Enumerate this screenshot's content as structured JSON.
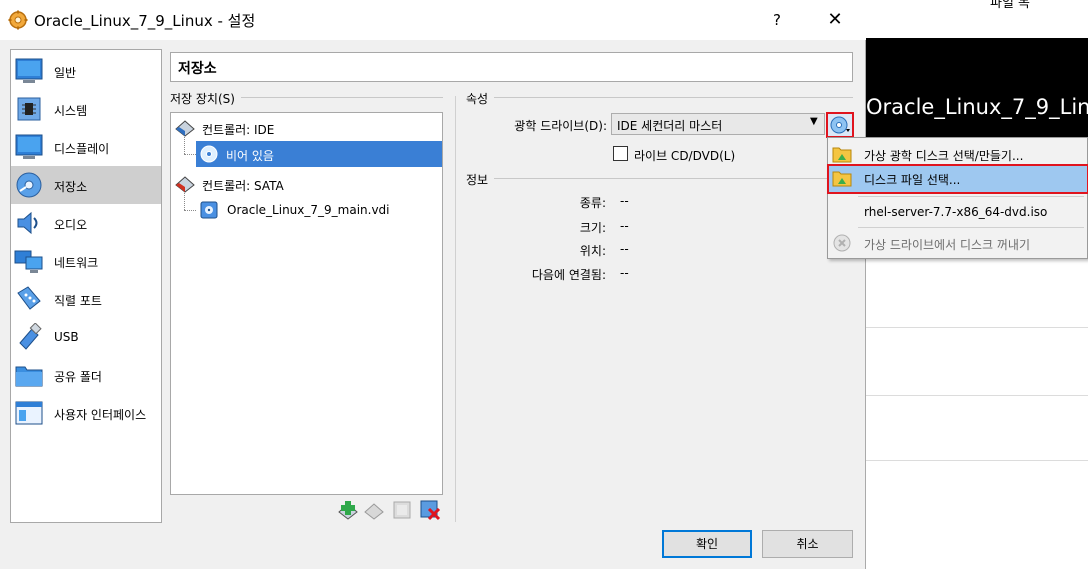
{
  "background_window": {
    "title_fragment": "파일 목",
    "preview_text": "Oracle_Linux_7_9_Lin"
  },
  "dialog": {
    "title": "Oracle_Linux_7_9_Linux - 설정",
    "help_label": "?",
    "close_label": "✕"
  },
  "nav": {
    "items": [
      {
        "label": "일반",
        "icon": "general-icon"
      },
      {
        "label": "시스템",
        "icon": "system-icon"
      },
      {
        "label": "디스플레이",
        "icon": "display-icon"
      },
      {
        "label": "저장소",
        "icon": "storage-icon"
      },
      {
        "label": "오디오",
        "icon": "audio-icon"
      },
      {
        "label": "네트워크",
        "icon": "network-icon"
      },
      {
        "label": "직렬 포트",
        "icon": "serial-port-icon"
      },
      {
        "label": "USB",
        "icon": "usb-icon"
      },
      {
        "label": "공유 폴더",
        "icon": "shared-folder-icon"
      },
      {
        "label": "사용자 인터페이스",
        "icon": "user-interface-icon"
      }
    ],
    "selected": "저장소"
  },
  "page": {
    "title": "저장소"
  },
  "storage": {
    "group_label": "저장 장치(S)",
    "tree": {
      "controller_ide": "컨트롤러: IDE",
      "ide_child": "비어 있음",
      "controller_sata": "컨트롤러: SATA",
      "sata_child": "Oracle_Linux_7_9_main.vdi"
    }
  },
  "attributes": {
    "group_label": "속성",
    "drive_label": "광학 드라이브(D):",
    "drive_value": "IDE 세컨더리 마스터",
    "live_label": "라이브 CD/DVD(L)",
    "live_checked": false
  },
  "info": {
    "group_label": "정보",
    "rows": [
      {
        "label": "종류:",
        "value": "--"
      },
      {
        "label": "크기:",
        "value": "--"
      },
      {
        "label": "위치:",
        "value": "--"
      },
      {
        "label": "다음에 연결됨:",
        "value": "--"
      }
    ]
  },
  "buttons": {
    "ok": "확인",
    "cancel": "취소"
  },
  "menu": {
    "items": [
      {
        "label": "가상 광학 디스크 선택/만들기...",
        "icon": "folder-disk-icon"
      },
      {
        "label": "디스크 파일 선택...",
        "icon": "folder-disk-icon",
        "highlighted": true
      },
      {
        "label": "rhel-server-7.7-x86_64-dvd.iso",
        "icon": ""
      },
      {
        "label": "가상 드라이브에서 디스크 꺼내기",
        "icon": "eject-disk-icon",
        "disabled": true
      }
    ]
  },
  "colors": {
    "selection_blue": "#3a7fd5",
    "highlight_red": "#e0141e",
    "menu_highlight": "#9ec8f0"
  }
}
